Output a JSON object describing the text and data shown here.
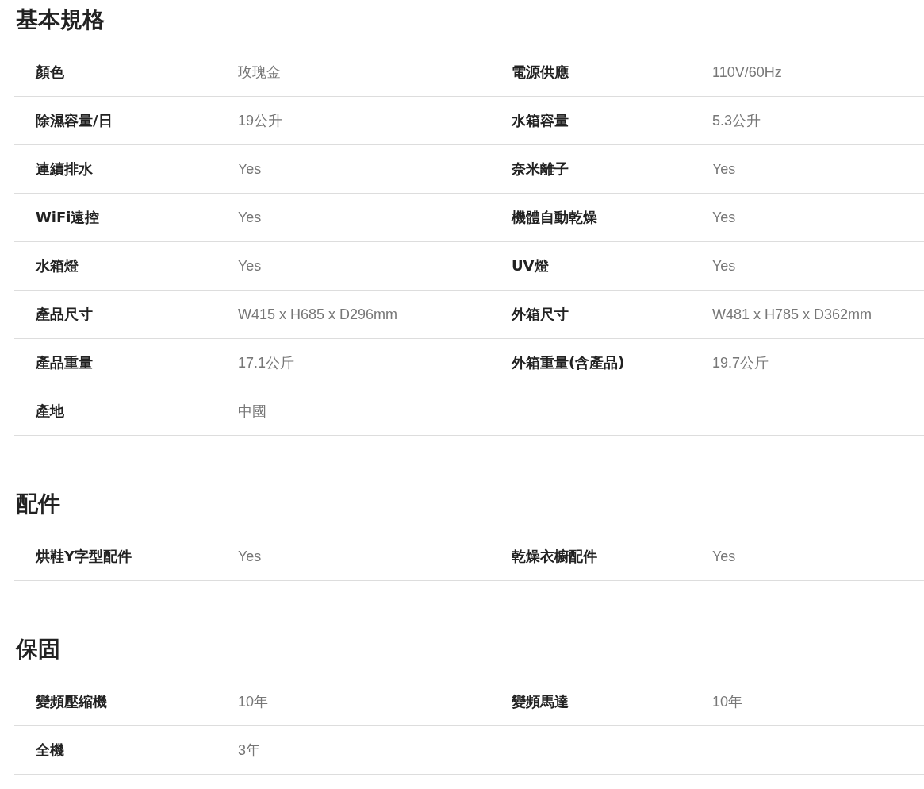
{
  "sections": [
    {
      "title": "基本規格",
      "rows": [
        {
          "cells": [
            {
              "label": "顏色",
              "value": "玫瑰金"
            },
            {
              "label": "電源供應",
              "value": "110V/60Hz"
            }
          ]
        },
        {
          "cells": [
            {
              "label": "除濕容量/日",
              "value": "19公升"
            },
            {
              "label": "水箱容量",
              "value": "5.3公升"
            }
          ]
        },
        {
          "cells": [
            {
              "label": "連續排水",
              "value": "Yes"
            },
            {
              "label": "奈米離子",
              "value": "Yes"
            }
          ]
        },
        {
          "cells": [
            {
              "label": "WiFi遠控",
              "value": "Yes"
            },
            {
              "label": "機體自動乾燥",
              "value": "Yes"
            }
          ]
        },
        {
          "cells": [
            {
              "label": "水箱燈",
              "value": "Yes"
            },
            {
              "label": "UV燈",
              "value": "Yes"
            }
          ]
        },
        {
          "cells": [
            {
              "label": "產品尺寸",
              "value": "W415 x H685 x D296mm"
            },
            {
              "label": "外箱尺寸",
              "value": "W481 x H785 x D362mm"
            }
          ]
        },
        {
          "cells": [
            {
              "label": "產品重量",
              "value": "17.1公斤"
            },
            {
              "label": "外箱重量(含產品)",
              "value": "19.7公斤"
            }
          ]
        },
        {
          "cells": [
            {
              "label": "產地",
              "value": "中國"
            }
          ]
        }
      ]
    },
    {
      "title": "配件",
      "rows": [
        {
          "cells": [
            {
              "label": "烘鞋Y字型配件",
              "value": "Yes"
            },
            {
              "label": "乾燥衣櫥配件",
              "value": "Yes"
            }
          ]
        }
      ]
    },
    {
      "title": "保固",
      "rows": [
        {
          "cells": [
            {
              "label": "變頻壓縮機",
              "value": "10年"
            },
            {
              "label": "變頻馬達",
              "value": "10年"
            }
          ]
        },
        {
          "cells": [
            {
              "label": "全機",
              "value": "3年"
            }
          ]
        }
      ]
    }
  ]
}
